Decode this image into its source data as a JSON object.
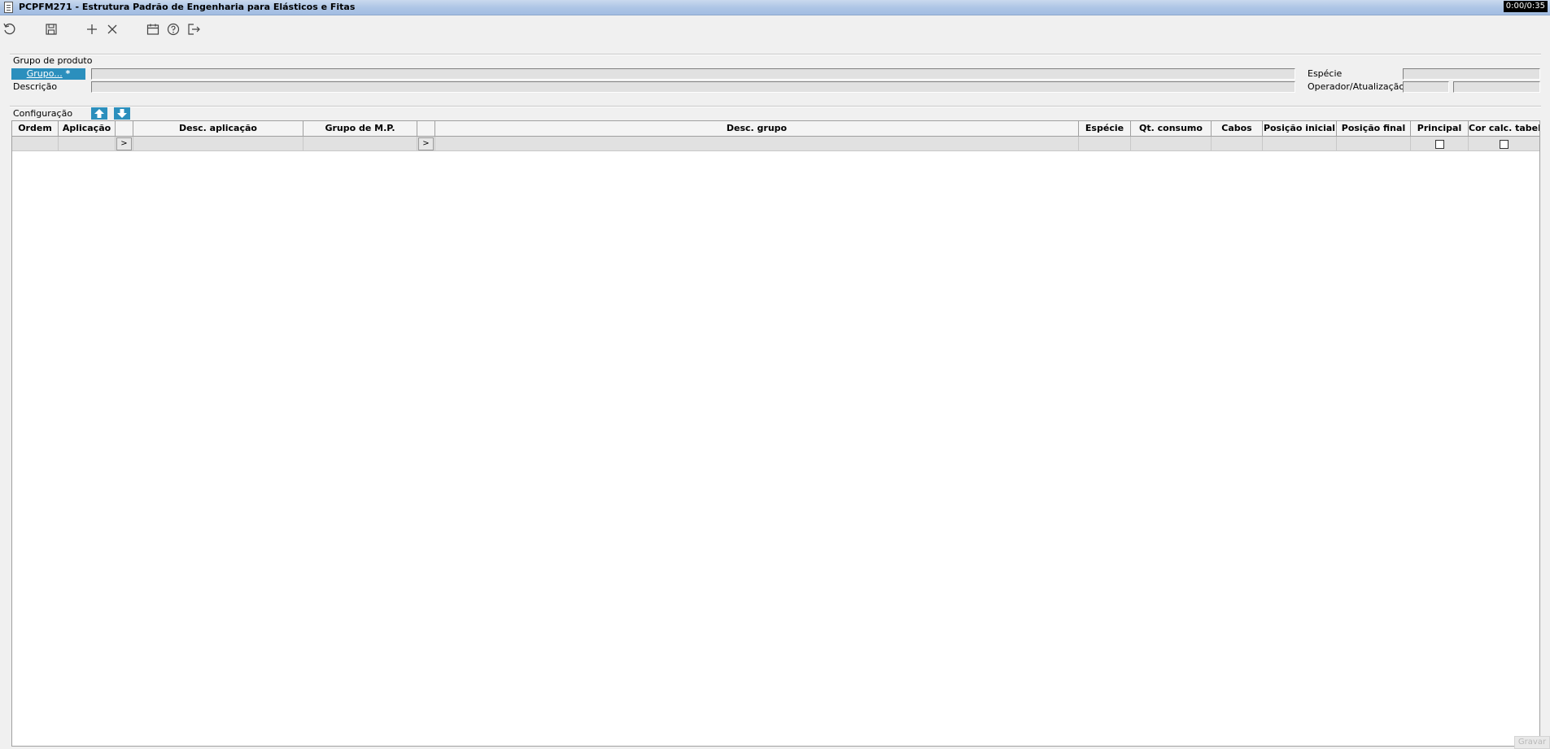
{
  "window": {
    "title": "PCPFM271 - Estrutura Padrão de Engenharia para Elásticos e Fitas",
    "timer": "0:00/0:35"
  },
  "toolbar": {
    "buttons": [
      {
        "name": "refresh",
        "icon": "refresh-icon"
      },
      {
        "name": "save",
        "icon": "save-icon"
      },
      {
        "name": "add",
        "icon": "plus-icon"
      },
      {
        "name": "delete",
        "icon": "close-icon"
      },
      {
        "name": "calendar",
        "icon": "calendar-icon"
      },
      {
        "name": "help",
        "icon": "help-icon"
      },
      {
        "name": "exit",
        "icon": "exit-icon"
      }
    ]
  },
  "grupo_produto": {
    "section_label": "Grupo de produto",
    "grupo_button": "Grupo...",
    "grupo_required": " *",
    "grupo_value": "",
    "descricao_label": "Descrição",
    "descricao_value": "",
    "especie_label": "Espécie",
    "especie_value": "",
    "operador_label": "Operador/Atualização",
    "operador_value": "",
    "atualizacao_value": ""
  },
  "configuracao": {
    "section_label": "Configuração",
    "move_up_icon": "arrow-up-icon",
    "move_down_icon": "arrow-down-icon",
    "columns": [
      "Ordem",
      "Aplicação",
      "",
      "Desc. aplicação",
      "Grupo de M.P.",
      "",
      "Desc. grupo",
      "Espécie",
      "Qt. consumo",
      "Cabos",
      "Posição inicial",
      "Posição final",
      "Principal",
      "Cor calc. tabela"
    ],
    "lookup_label": ">",
    "rows": [
      {
        "ordem": "",
        "aplicacao": "",
        "desc_aplicacao": "",
        "grupo_mp": "",
        "desc_grupo": "",
        "especie": "",
        "qt_consumo": "",
        "cabos": "",
        "posicao_inicial": "",
        "posicao_final": "",
        "principal": false,
        "cor_calc_tabela": false
      }
    ]
  },
  "status": {
    "text": "Gravar"
  }
}
